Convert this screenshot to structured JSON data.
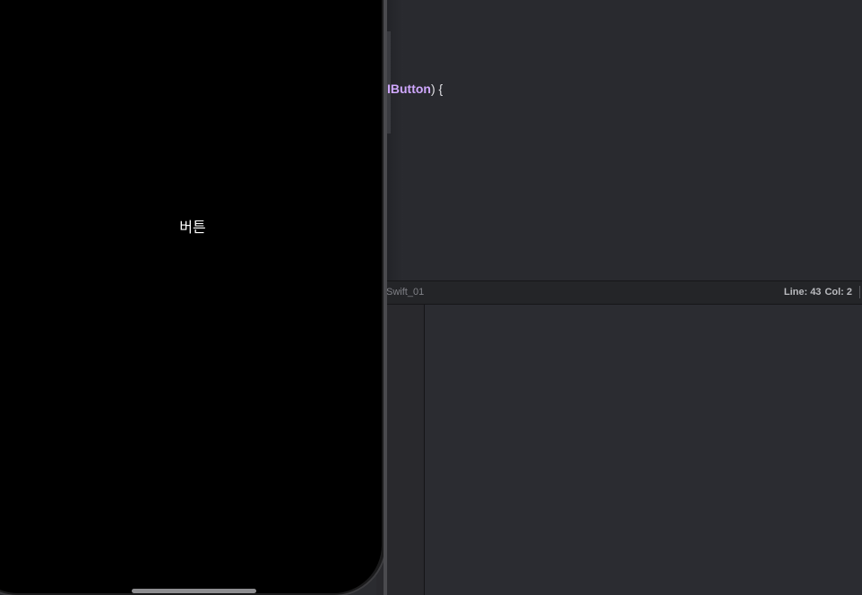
{
  "editor": {
    "code_fragment_type": "IButton",
    "code_fragment_tail": ") {"
  },
  "status_bar": {
    "breadcrumb": "Swift_01",
    "line_label": "Line: 43",
    "col_label": "Col: 2"
  },
  "simulator": {
    "button_label": "버튼"
  }
}
